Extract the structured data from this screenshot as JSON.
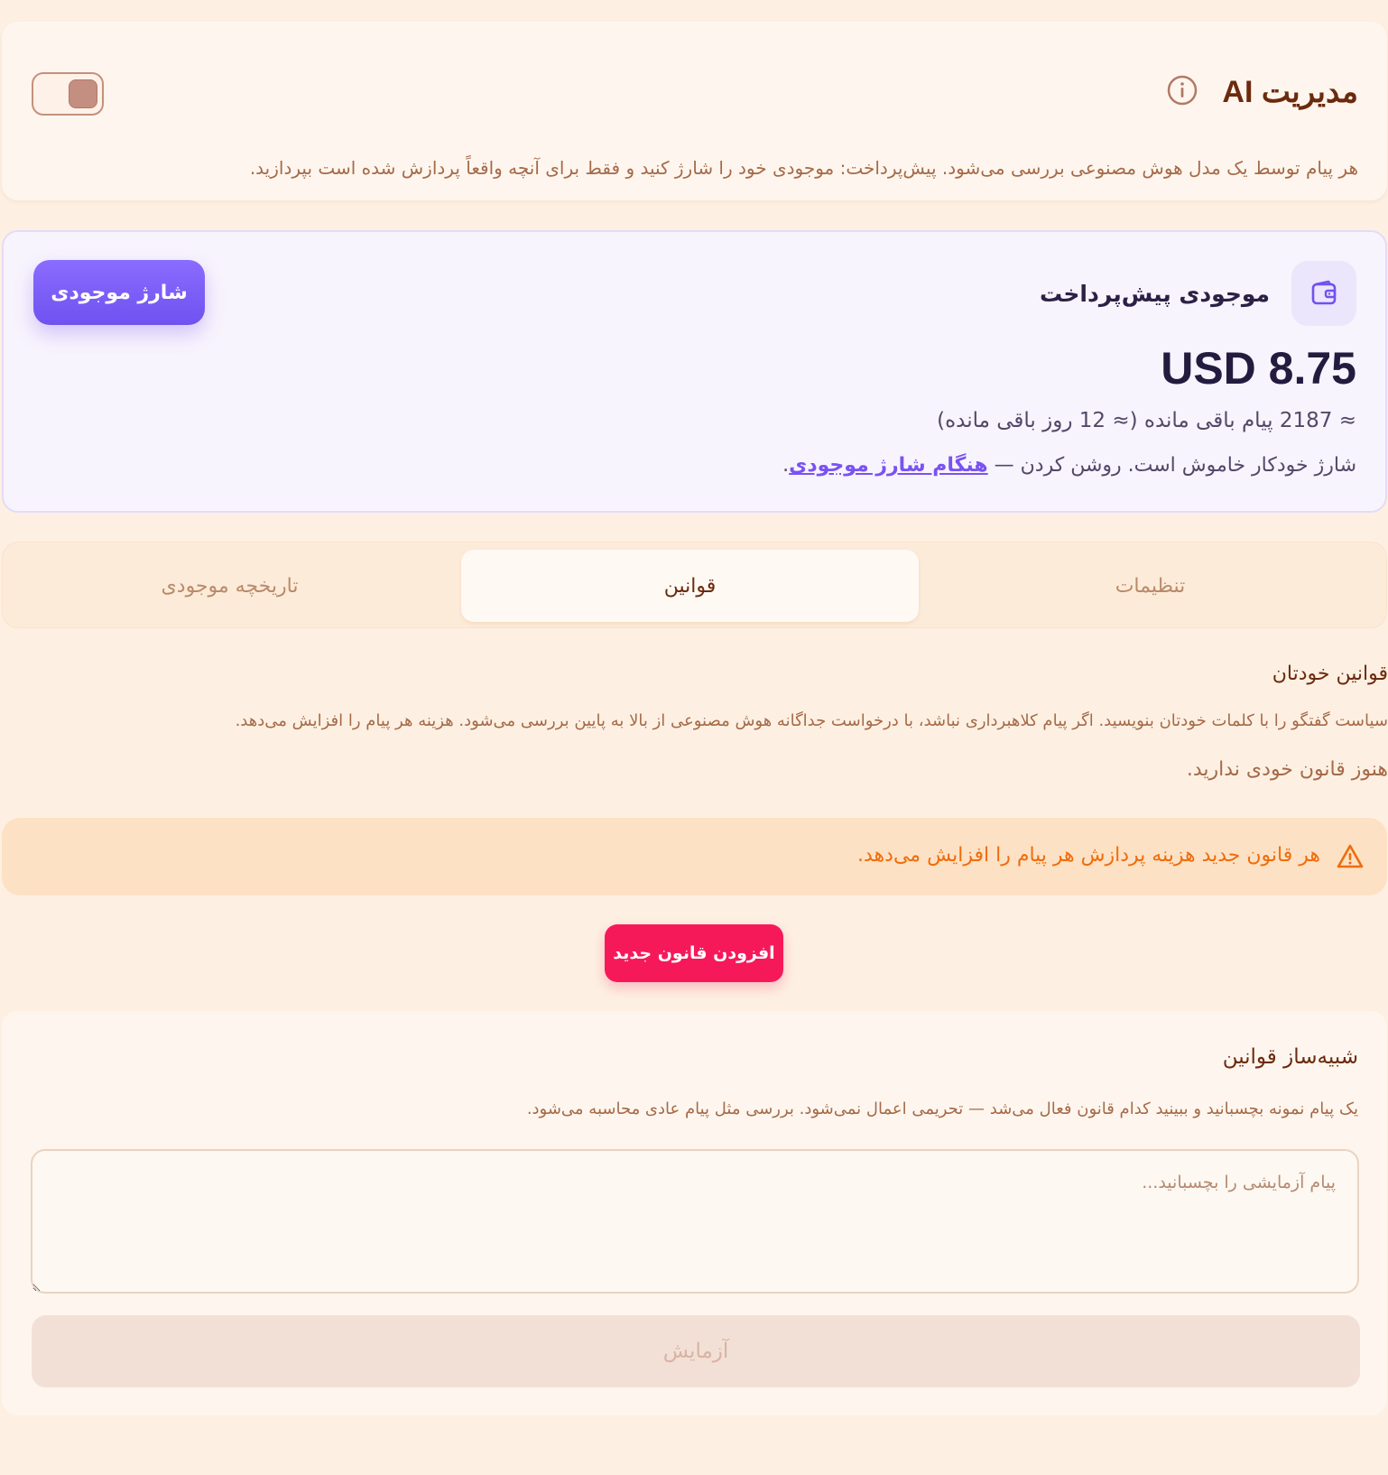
{
  "header": {
    "title": "مدیریت AI",
    "description": "هر پیام توسط یک مدل هوش مصنوعی بررسی می‌شود. پیش‌پرداخت: موجودی خود را شارژ کنید و فقط برای آنچه واقعاً پردازش شده است بپردازید.",
    "toggle_on": false
  },
  "balance": {
    "title": "موجودی پیش‌پرداخت",
    "amount": "USD 8.75",
    "estimate": "≈ 2187 پیام باقی مانده (≈ 12 روز باقی مانده)",
    "autocharge_text": "شارژ خودکار خاموش است. روشن کردن — ",
    "autocharge_link": "هنگام شارژ موجودی",
    "autocharge_end": ".",
    "charge_button": "شارژ موجودی",
    "accent_color": "#7a52f2"
  },
  "tabs": [
    {
      "label": "تنظیمات",
      "active": false
    },
    {
      "label": "قوانین",
      "active": true
    },
    {
      "label": "تاریخچه موجودی",
      "active": false
    }
  ],
  "rules": {
    "heading": "قوانین خودتان",
    "description": "سیاست گفتگو را با کلمات خودتان بنویسید. اگر پیام کلاهبرداری نباشد، با درخواست جداگانه هوش مصنوعی از بالا به پایین بررسی می‌شود. هزینه هر پیام را افزایش می‌دهد.",
    "empty_text": "هنوز قانون خودی ندارید.",
    "warning": "هر قانون جدید هزینه پردازش هر پیام را افزایش می‌دهد.",
    "add_button": "افزودن قانون جدید",
    "warning_color": "#ef6c0c",
    "add_color": "#f6195a"
  },
  "simulator": {
    "title": "شبیه‌ساز قوانین",
    "description": "یک پیام نمونه بچسبانید و ببینید کدام قانون فعال می‌شد — تحریمی اعمال نمی‌شود. بررسی مثل پیام عادی محاسبه می‌شود.",
    "input_value": "",
    "placeholder": "پیام آزمایشی را بچسبانید...",
    "test_button": "آزمایش"
  }
}
